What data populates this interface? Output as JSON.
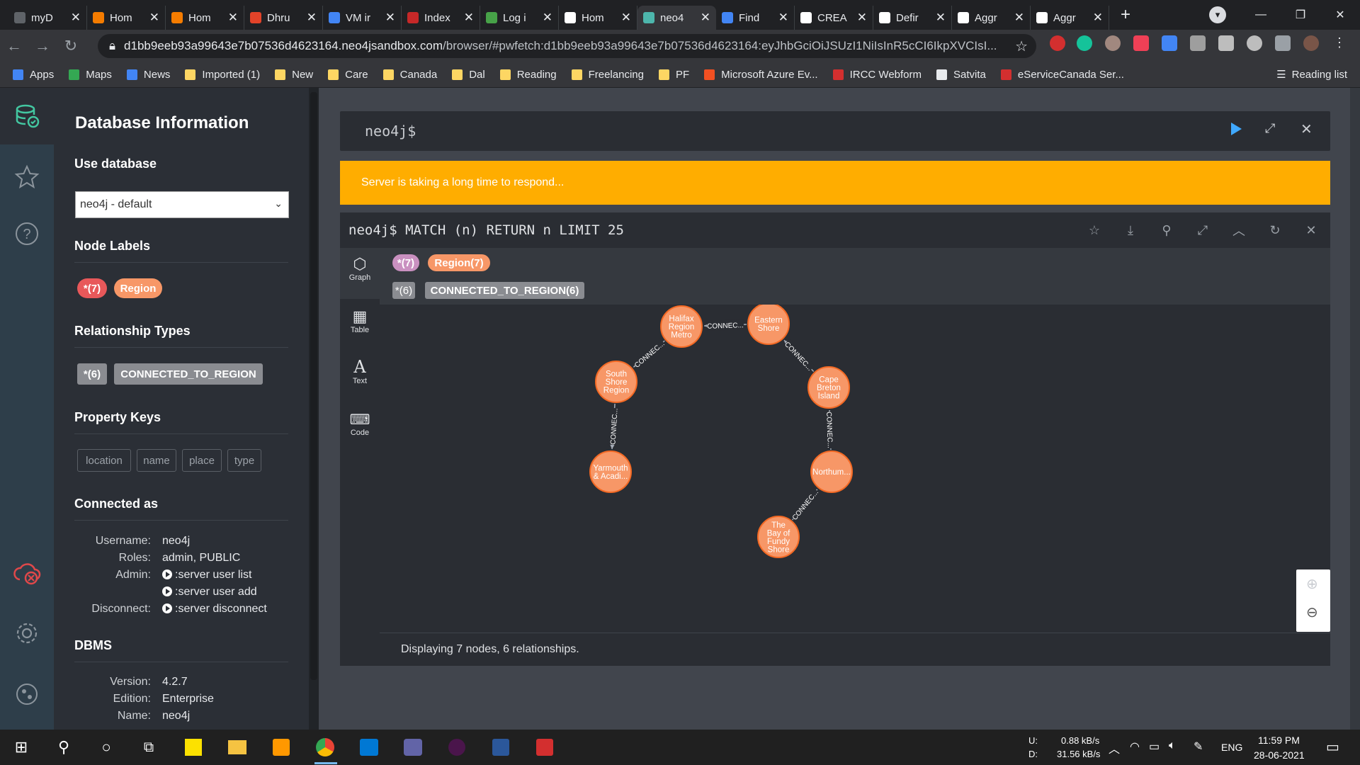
{
  "browser": {
    "tabs": [
      {
        "title": "myD",
        "color": "#5f6368"
      },
      {
        "title": "Hom",
        "color": "#f57c00"
      },
      {
        "title": "Hom",
        "color": "#f57c00"
      },
      {
        "title": "Dhru",
        "color": "#e24329"
      },
      {
        "title": "VM ir",
        "color": "#4285f4"
      },
      {
        "title": "Index",
        "color": "#c62828"
      },
      {
        "title": "Log i",
        "color": "#47a248"
      },
      {
        "title": "Hom",
        "color": "#ffffff"
      },
      {
        "title": "neo4",
        "color": "#4db6ac"
      },
      {
        "title": "Find",
        "color": "#4285f4"
      },
      {
        "title": "CREA",
        "color": "#ffffff"
      },
      {
        "title": "Defir",
        "color": "#ffffff"
      },
      {
        "title": "Aggr",
        "color": "#ffffff"
      },
      {
        "title": "Aggr",
        "color": "#ffffff"
      }
    ],
    "active_tab_index": 8,
    "url_host": "d1bb9eeb93a99643e7b07536d4623164.neo4jsandbox.com",
    "url_rest": "/browser/#pwfetch:d1bb9eeb93a99643e7b07536d4623164:eyJhbGciOiJSUzI1NiIsInR5cCI6IkpXVCIsI...",
    "bookmarks": [
      {
        "label": "Apps",
        "color": "#4285f4"
      },
      {
        "label": "Maps",
        "color": "#34a853"
      },
      {
        "label": "News",
        "color": "#4285f4"
      },
      {
        "label": "Imported (1)",
        "color": "#fdd663"
      },
      {
        "label": "New",
        "color": "#fdd663"
      },
      {
        "label": "Care",
        "color": "#fdd663"
      },
      {
        "label": "Canada",
        "color": "#fdd663"
      },
      {
        "label": "Dal",
        "color": "#fdd663"
      },
      {
        "label": "Reading",
        "color": "#fdd663"
      },
      {
        "label": "Freelancing",
        "color": "#fdd663"
      },
      {
        "label": "PF",
        "color": "#fdd663"
      },
      {
        "label": "Microsoft Azure Ev...",
        "color": "#f25022"
      },
      {
        "label": "IRCC Webform",
        "color": "#d32f2f"
      },
      {
        "label": "Satvita",
        "color": "#e8eaed"
      },
      {
        "label": "eServiceCanada Ser...",
        "color": "#d32f2f"
      }
    ],
    "reading_list": "Reading list"
  },
  "sidebar": {
    "title": "Database Information",
    "use_database": {
      "heading": "Use database",
      "value": "neo4j - default"
    },
    "node_labels": {
      "heading": "Node Labels",
      "all": "*(7)",
      "items": [
        "Region"
      ]
    },
    "relationship_types": {
      "heading": "Relationship Types",
      "all": "*(6)",
      "items": [
        "CONNECTED_TO_REGION"
      ]
    },
    "property_keys": {
      "heading": "Property Keys",
      "items": [
        "location",
        "name",
        "place",
        "type"
      ]
    },
    "connected_as": {
      "heading": "Connected as",
      "username_label": "Username:",
      "username": "neo4j",
      "roles_label": "Roles:",
      "roles": "admin, PUBLIC",
      "admin_label": "Admin:",
      "admin_cmd1": ":server user list",
      "admin_cmd2": ":server user add",
      "disconnect_label": "Disconnect:",
      "disconnect_cmd": ":server disconnect"
    },
    "dbms": {
      "heading": "DBMS",
      "version_label": "Version:",
      "version": "4.2.7",
      "edition_label": "Edition:",
      "edition": "Enterprise",
      "name_label": "Name:",
      "name": "neo4j"
    }
  },
  "editor": {
    "prompt": "neo4j$"
  },
  "warning": "Server is taking a long time to respond...",
  "result": {
    "query": "neo4j$ MATCH (n) RETURN n LIMIT 25",
    "tabs": [
      "Graph",
      "Table",
      "Text",
      "Code"
    ],
    "legend_nodes": {
      "all": "*(7)",
      "label": "Region(7)"
    },
    "legend_rels": {
      "all": "*(6)",
      "label": "CONNECTED_TO_REGION(6)"
    },
    "status": "Displaying 7 nodes, 6 relationships.",
    "nodes": [
      {
        "id": "halifax",
        "label": [
          "Halifax",
          "Region",
          "Metro"
        ]
      },
      {
        "id": "eastern",
        "label": [
          "Eastern",
          "Shore"
        ]
      },
      {
        "id": "south",
        "label": [
          "South",
          "Shore",
          "Region"
        ]
      },
      {
        "id": "cape",
        "label": [
          "Cape",
          "Breton",
          "Island"
        ]
      },
      {
        "id": "yarmouth",
        "label": [
          "Yarmouth",
          "& Acadi..."
        ]
      },
      {
        "id": "northum",
        "label": [
          "Northum..."
        ]
      },
      {
        "id": "fundy",
        "label": [
          "The",
          "Bay of",
          "Fundy",
          "Shore"
        ]
      }
    ],
    "edges": [
      {
        "from": "eastern",
        "to": "halifax",
        "label": "CONNEC..."
      },
      {
        "from": "halifax",
        "to": "south",
        "label": "CONNEC..."
      },
      {
        "from": "cape",
        "to": "eastern",
        "label": "CONNEC..."
      },
      {
        "from": "south",
        "to": "yarmouth",
        "label": "CONNEC..."
      },
      {
        "from": "northum",
        "to": "cape",
        "label": "CONNEC..."
      },
      {
        "from": "fundy",
        "to": "northum",
        "label": "CONNEC..."
      }
    ],
    "node_color": "#f79767",
    "label_color": "#c990c0"
  },
  "taskbar": {
    "net_up_label": "U:",
    "net_up": "0.88 kB/s",
    "net_down_label": "D:",
    "net_down": "31.56 kB/s",
    "lang": "ENG",
    "time": "11:59 PM",
    "date": "28-06-2021"
  }
}
